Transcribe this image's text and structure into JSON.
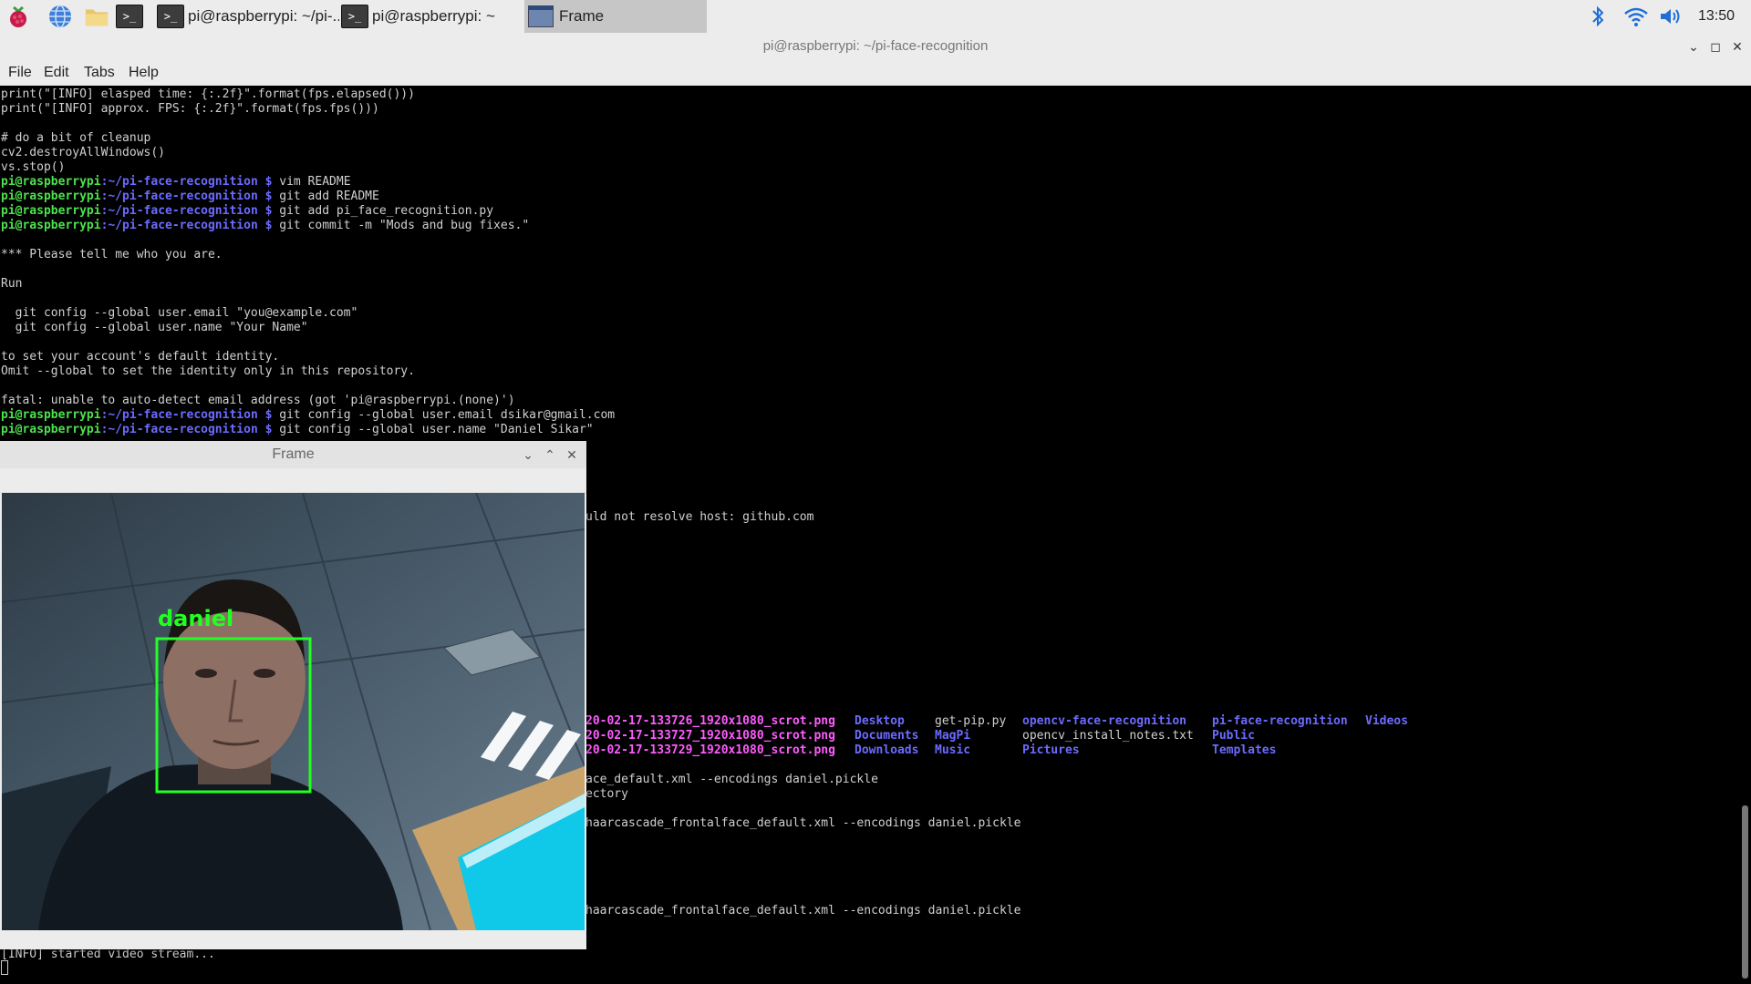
{
  "taskbar": {
    "tasks": [
      {
        "label": "pi@raspberrypi: ~/pi-..."
      },
      {
        "label": "pi@raspberrypi: ~"
      },
      {
        "label": "Frame"
      }
    ],
    "terminal_glyph": ">_",
    "clock": "13:50"
  },
  "terminal": {
    "title": "pi@raspberrypi: ~/pi-face-recognition",
    "menu": [
      "File",
      "Edit",
      "Tabs",
      "Help"
    ],
    "prompt_user": "pi@raspberrypi",
    "prompt_path": ":~/pi-face-recognition $",
    "lines": [
      "print(\"[INFO] elasped time: {:.2f}\".format(fps.elapsed()))",
      "print(\"[INFO] approx. FPS: {:.2f}\".format(fps.fps()))",
      "",
      "# do a bit of cleanup",
      "cv2.destroyAllWindows()",
      "vs.stop()"
    ],
    "commands": [
      " vim README",
      " git add README",
      " git add pi_face_recognition.py",
      " git commit -m \"Mods and bug fixes.\""
    ],
    "output": [
      "*** Please tell me who you are.",
      "Run",
      "  git config --global user.email \"you@example.com\"",
      "  git config --global user.name \"Your Name\"",
      "to set your account's default identity.",
      "Omit --global to set the identity only in this repository.",
      "fatal: unable to auto-detect email address (got 'pi@raspberrypi.(none)')"
    ],
    "commands2": [
      " git config --global user.email dsikar@gmail.com",
      " git config --global user.name \"Daniel Sikar\""
    ],
    "partial": {
      "resolve": "uld not resolve host: github.com",
      "haar1": "ace_default.xml --encodings daniel.pickle",
      "ectory": "ectory",
      "haar2": "haarcascade_frontalface_default.xml --encodings daniel.pickle",
      "haar3": "haarcascade_frontalface_default.xml --encodings daniel.pickle",
      "started": "[INFO] started video stream..."
    },
    "listing": {
      "scrots": [
        "20-02-17-133726_1920x1080_scrot.png",
        "20-02-17-133727_1920x1080_scrot.png",
        "20-02-17-133729_1920x1080_scrot.png"
      ],
      "col2": [
        "Desktop",
        "Documents",
        "Downloads"
      ],
      "col3": [
        "get-pip.py",
        "MagPi",
        "Music"
      ],
      "col4": [
        "opencv-face-recognition",
        "opencv_install_notes.txt",
        "Pictures"
      ],
      "col5": [
        "pi-face-recognition",
        "Public",
        "Templates"
      ],
      "col6": [
        "Videos"
      ]
    }
  },
  "frame_window": {
    "title": "Frame",
    "face_label": "daniel"
  }
}
